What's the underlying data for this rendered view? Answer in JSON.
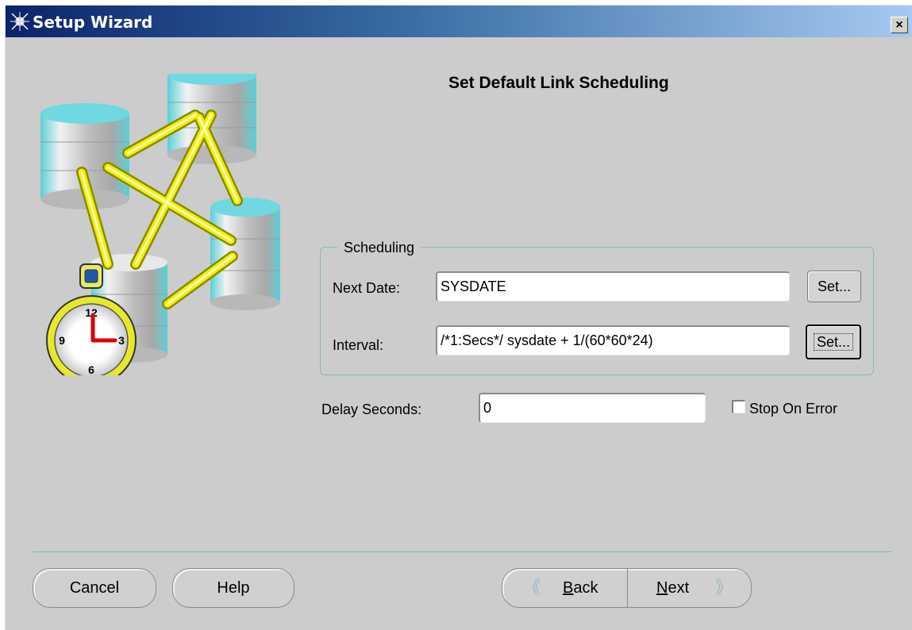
{
  "window": {
    "title": "Setup Wizard",
    "close_label": "×"
  },
  "page": {
    "title": "Set Default Link Scheduling"
  },
  "scheduling": {
    "group_label": "Scheduling",
    "next_date_label": "Next Date:",
    "next_date_value": "SYSDATE",
    "next_date_button": "Set...",
    "interval_label": "Interval:",
    "interval_value": "/*1:Secs*/ sysdate + 1/(60*60*24)",
    "interval_button": "Set..."
  },
  "delay": {
    "label": "Delay Seconds:",
    "value": "0"
  },
  "stop_on_error": {
    "label": "Stop On Error",
    "checked": false
  },
  "illustration": {
    "clock_numbers": [
      "12",
      "3",
      "6",
      "9"
    ]
  },
  "footer": {
    "cancel_label": "Cancel",
    "help_label": "Help",
    "back_label": "Back",
    "next_label": "Next",
    "back_icon": "double-chevron-left-icon",
    "next_icon": "double-chevron-right-icon"
  },
  "colors": {
    "title_gradient_start": "#0a246a",
    "dialog_bg": "#cccccc",
    "link_yellow": "#f0f000",
    "db_cyan": "#66d4dc"
  }
}
